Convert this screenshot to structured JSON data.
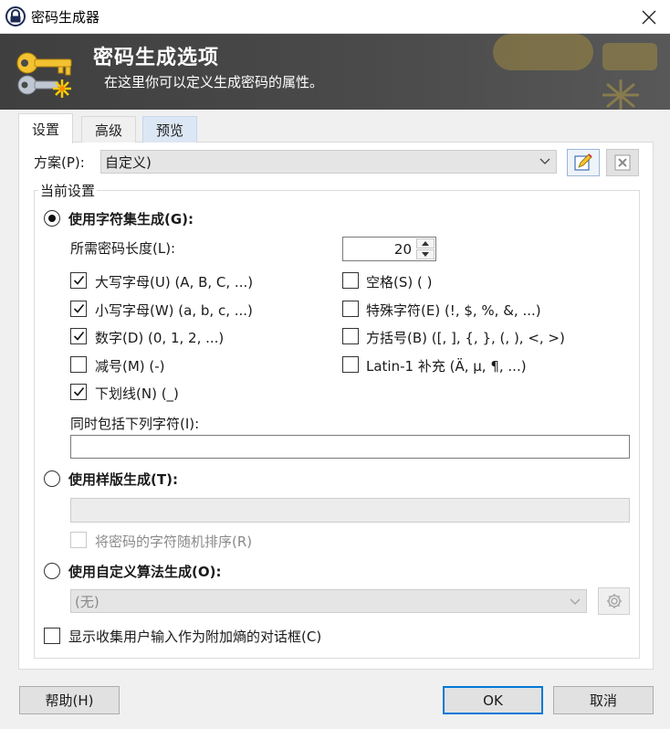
{
  "window": {
    "title": "密码生成器",
    "close_icon": "close-icon",
    "app_icon": "keepass-lock-icon"
  },
  "banner": {
    "title": "密码生成选项",
    "subtitle": "在这里你可以定义生成密码的属性。",
    "icon": "keys-icon"
  },
  "tabs": [
    {
      "label": "设置",
      "active": true
    },
    {
      "label": "高级",
      "active": false
    },
    {
      "label": "预览",
      "active": false
    }
  ],
  "profile": {
    "label": "方案(P):",
    "value": "自定义)",
    "edit_icon": "edit-profile-icon",
    "delete_icon": "delete-profile-icon"
  },
  "settings": {
    "caption": "当前设置",
    "charset_mode": {
      "label": "使用字符集生成(G):",
      "selected": true,
      "length_label": "所需密码长度(L):",
      "length_value": "20",
      "charsets": [
        {
          "label": "大写字母(U) (A, B, C, ...)",
          "checked": true
        },
        {
          "label": "空格(S) ( )",
          "checked": false
        },
        {
          "label": "小写字母(W) (a, b, c, ...)",
          "checked": true
        },
        {
          "label": "特殊字符(E) (!, $, %, &, ...)",
          "checked": false
        },
        {
          "label": "数字(D) (0, 1, 2, ...)",
          "checked": true
        },
        {
          "label": "方括号(B) ([, ], {, }, (, ), <, >)",
          "checked": false
        },
        {
          "label": "减号(M) (-)",
          "checked": false
        },
        {
          "label": "Latin-1 补充 (Ä, µ, ¶, ...)",
          "checked": false
        },
        {
          "label": "下划线(N) (_)",
          "checked": true
        }
      ],
      "include_label": "同时包括下列字符(I):",
      "include_value": ""
    },
    "pattern_mode": {
      "label": "使用样版生成(T):",
      "selected": false,
      "pattern_value": "",
      "shuffle_label": "将密码的字符随机排序(R)",
      "shuffle_checked": false
    },
    "custom_mode": {
      "label": "使用自定义算法生成(O):",
      "selected": false,
      "algorithm_value": "(无)",
      "gear_icon": "gear-icon"
    },
    "entropy_label": "显示收集用户输入作为附加熵的对话框(C)",
    "entropy_checked": false
  },
  "buttons": {
    "help": "帮助(H)",
    "ok": "OK",
    "cancel": "取消"
  },
  "colors": {
    "accent": "#0078d7",
    "banner_bg": "#4a4a4a"
  }
}
